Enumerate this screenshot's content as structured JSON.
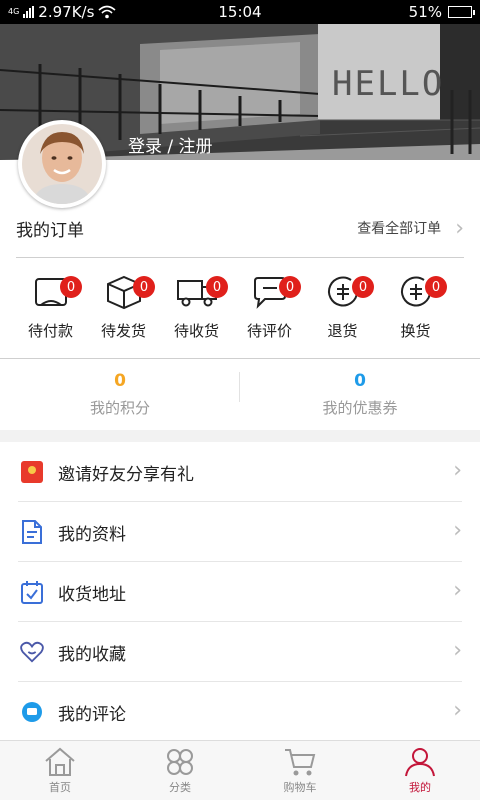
{
  "status_bar": {
    "network_tag": "4G",
    "speed": "2.97K/s",
    "time": "15:04",
    "battery": "51%",
    "battery_level": 0.51
  },
  "header": {
    "wall_text": "HELLO",
    "login_label": "登录 / 注册"
  },
  "orders": {
    "title": "我的订单",
    "view_all": "查看全部订单",
    "items": [
      {
        "label": "待付款",
        "badge": "0",
        "icon": "wallet-icon"
      },
      {
        "label": "待发货",
        "badge": "0",
        "icon": "package-icon"
      },
      {
        "label": "待收货",
        "badge": "0",
        "icon": "truck-icon"
      },
      {
        "label": "待评价",
        "badge": "0",
        "icon": "comment-icon"
      },
      {
        "label": "退货",
        "badge": "0",
        "icon": "return-icon"
      },
      {
        "label": "换货",
        "badge": "0",
        "icon": "exchange-icon"
      }
    ]
  },
  "stats": {
    "points": {
      "value": "0",
      "label": "我的积分",
      "color": "#f5a623"
    },
    "coupons": {
      "value": "0",
      "label": "我的优惠券",
      "color": "#1e9be9"
    }
  },
  "menu": [
    {
      "label": "邀请好友分享有礼",
      "icon": "gift-envelope-icon"
    },
    {
      "label": "我的资料",
      "icon": "document-icon"
    },
    {
      "label": "收货地址",
      "icon": "calendar-check-icon"
    },
    {
      "label": "我的收藏",
      "icon": "heart-icon"
    },
    {
      "label": "我的评论",
      "icon": "chat-bubble-icon"
    }
  ],
  "tabbar": [
    {
      "label": "首页",
      "icon": "home-icon",
      "active": false
    },
    {
      "label": "分类",
      "icon": "category-icon",
      "active": false
    },
    {
      "label": "购物车",
      "icon": "cart-icon",
      "active": false
    },
    {
      "label": "我的",
      "icon": "user-icon",
      "active": true
    }
  ],
  "colors": {
    "badge": "#e0201b",
    "active_tab": "#c3163a",
    "icon_accent": "#3a6fd8"
  }
}
